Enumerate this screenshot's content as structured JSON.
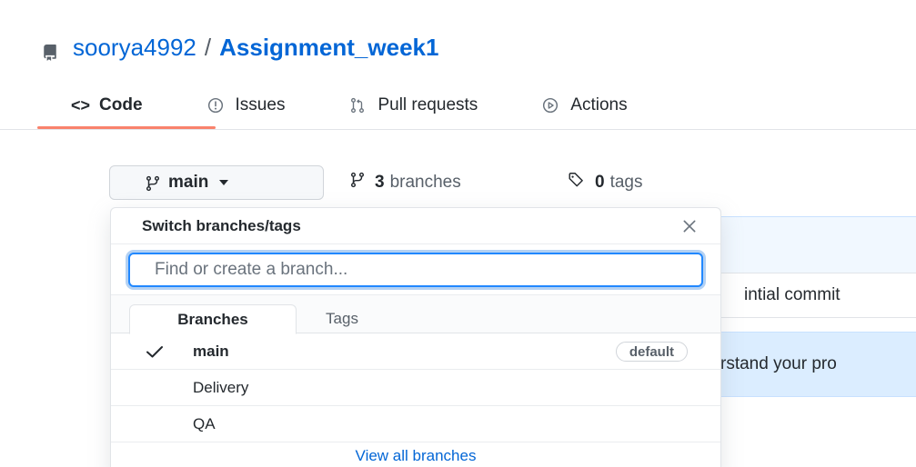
{
  "repo": {
    "owner": "soorya4992",
    "separator": "/",
    "name": "Assignment_week1"
  },
  "tabs": [
    {
      "label": "Code",
      "icon": "code-icon",
      "active": true
    },
    {
      "label": "Issues",
      "icon": "issue-opened-icon",
      "active": false
    },
    {
      "label": "Pull requests",
      "icon": "git-pull-request-icon",
      "active": false
    },
    {
      "label": "Actions",
      "icon": "play-icon",
      "active": false
    }
  ],
  "branch_selector": {
    "current": "main",
    "icon": "git-branch-icon"
  },
  "branches_link": {
    "count": "3",
    "label": "branches"
  },
  "tags_link": {
    "count": "0",
    "label": "tags"
  },
  "background": {
    "commit_message": "intial commit",
    "readme_hint": "rstand your pro"
  },
  "dropdown": {
    "title": "Switch branches/tags",
    "search_placeholder": "Find or create a branch...",
    "tabs": [
      {
        "label": "Branches",
        "active": true
      },
      {
        "label": "Tags",
        "active": false
      }
    ],
    "items": [
      {
        "name": "main",
        "selected": true,
        "badge": "default"
      },
      {
        "name": "Delivery",
        "selected": false,
        "badge": ""
      },
      {
        "name": "QA",
        "selected": false,
        "badge": ""
      }
    ],
    "footer_link": "View all branches"
  },
  "colors": {
    "link": "#0366d6",
    "tab_underline": "#f9826c",
    "focus_ring": "#2188ff"
  }
}
